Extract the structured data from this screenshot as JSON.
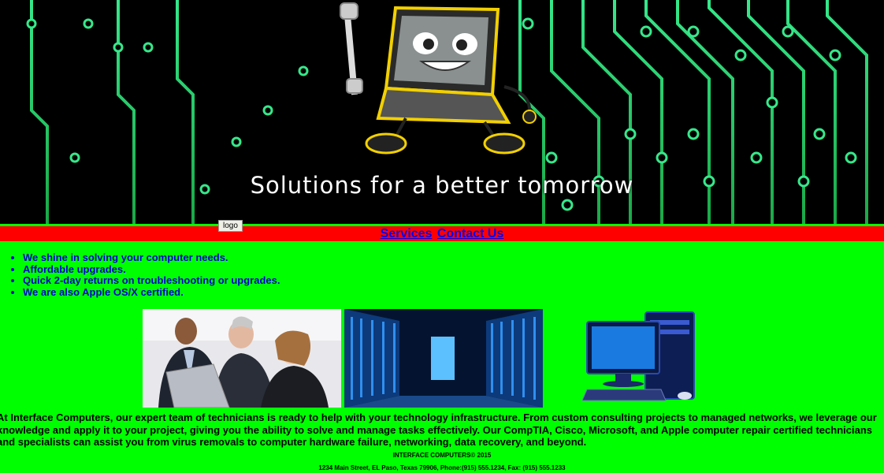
{
  "banner": {
    "slogan": "Solutions for a better tomorrow"
  },
  "logo": {
    "label": "logo"
  },
  "nav": {
    "services": "Services",
    "contact": "Contact Us"
  },
  "features": [
    "We shine in solving your computer needs.",
    "Affordable upgrades.",
    "Quick 2-day returns on troubleshooting or upgrades.",
    "We are also Apple OS/X certified."
  ],
  "description": "At Interface Computers, our expert team of technicians is ready to help with your technology infrastructure. From custom consulting projects to managed networks, we leverage our knowledge and apply it to your project, giving you the ability to solve and manage tasks effectively. Our CompTIA, Cisco, Microsoft, and Apple computer repair certified technicians and specialists can assist you from virus removals to computer hardware failure, networking, data recovery, and beyond.",
  "footer": {
    "copyright": "INTERFACE COMPUTERS© 2015",
    "address": "1234 Main Street, EL Paso, Texas 79906, Phone:(915) 555.1234, Fax: (915) 555.1233"
  },
  "colors": {
    "page_bg": "#00ff00",
    "nav_bg": "#ff0000",
    "link": "#0000ee",
    "feature_text": "#0000cc"
  }
}
